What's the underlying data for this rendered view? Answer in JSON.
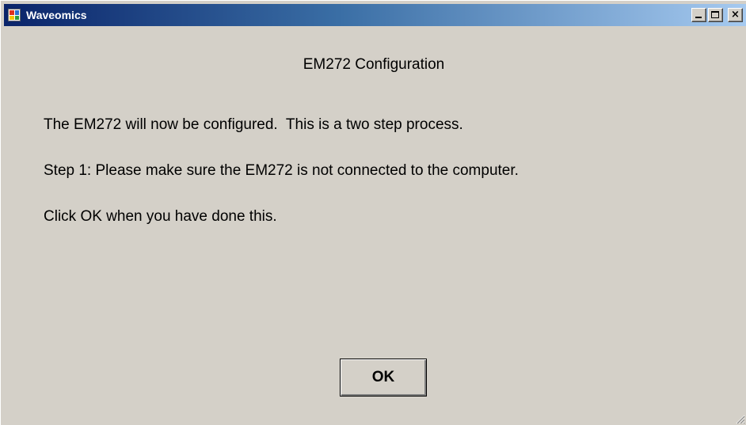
{
  "window": {
    "title": "Waveomics",
    "icon": "app-icon",
    "controls": {
      "minimize_icon": "minimize-icon",
      "maximize_icon": "maximize-icon",
      "close_label": "×",
      "close_icon": "close-icon"
    }
  },
  "dialog": {
    "heading": "EM272 Configuration",
    "messages": [
      "The EM272 will now be configured.  This is a two step process.",
      "Step 1: Please make sure the EM272 is not connected to the computer.",
      "Click OK when you have done this."
    ],
    "ok_label": "OK"
  },
  "colors": {
    "titlebar_start": "#0a246a",
    "titlebar_end": "#a6caf0",
    "face": "#d4d0c8"
  }
}
